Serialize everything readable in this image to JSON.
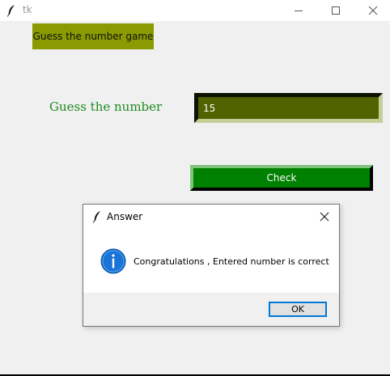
{
  "window": {
    "title": "tk",
    "icon": "feather-icon",
    "controls": [
      "minimize-icon",
      "maximize-icon",
      "close-icon"
    ]
  },
  "app": {
    "game_label": "Guess the number game",
    "guess_label": "Guess the number",
    "entry_value": "15",
    "check_label": "Check",
    "colors": {
      "game_label_bg": "#8a9a00",
      "guess_label_fg": "#1f8a1f",
      "entry_bg": "#4f6200",
      "check_bg": "#008000"
    }
  },
  "dialog": {
    "title": "Answer",
    "icon": "feather-icon",
    "message_icon": "info-icon",
    "message": "Congratulations , Entered number is correct",
    "ok_label": "OK"
  }
}
